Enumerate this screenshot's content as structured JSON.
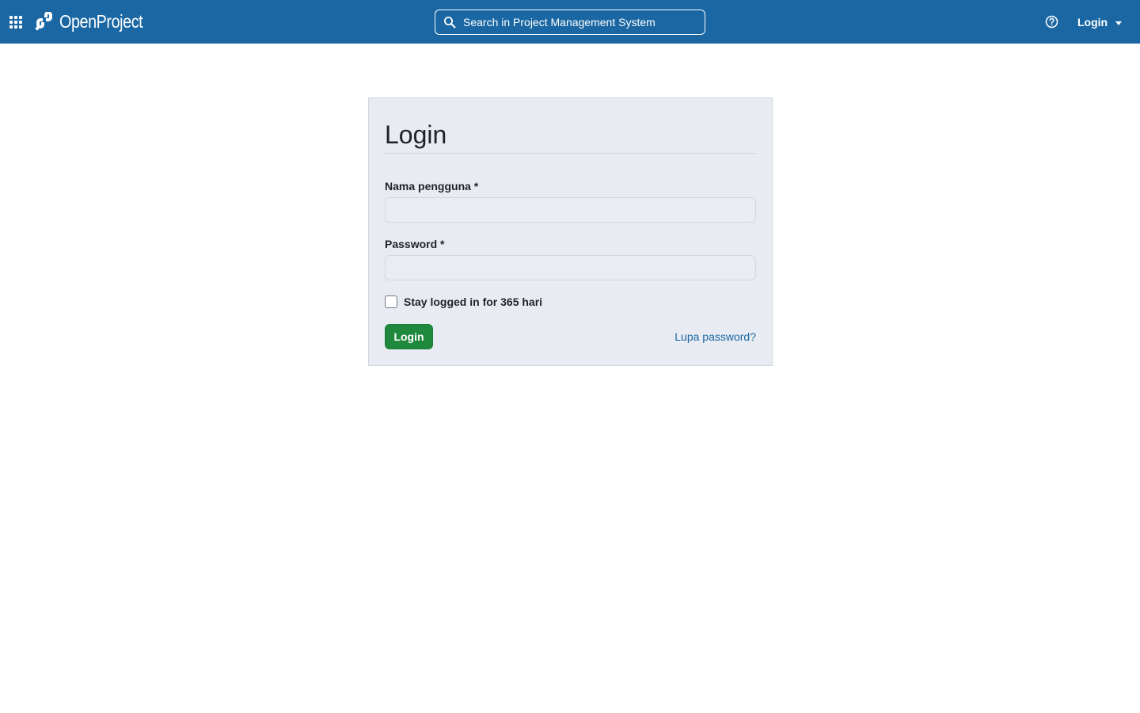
{
  "header": {
    "app_name": "OpenProject",
    "search_placeholder": "Search in Project Management System",
    "login_label": "Login"
  },
  "login_form": {
    "title": "Login",
    "username_label": "Nama pengguna *",
    "username_value": "",
    "password_label": "Password *",
    "password_value": "",
    "remember_label": "Stay logged in for 365 hari",
    "remember_checked": false,
    "submit_label": "Login",
    "lost_password_label": "Lupa password?"
  },
  "colors": {
    "header_bg": "#1a67a3",
    "submit_bg": "#1f883d",
    "link": "#1a67a3",
    "panel_bg": "#e8ecf2"
  },
  "icons": {
    "modules": "grid-icon",
    "logo": "openproject-logo-icon",
    "search": "search-icon",
    "help": "help-icon",
    "dropdown": "caret-down-icon"
  }
}
